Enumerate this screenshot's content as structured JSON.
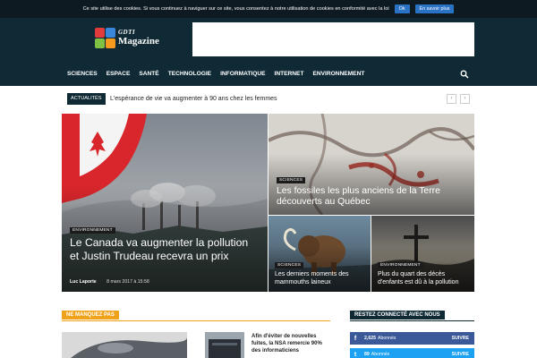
{
  "cookie": {
    "text": "Ce site utilise des cookies. Si vous continuez à naviguer sur ce site, vous consentez à notre utilisation de cookies en conformité avec la loi",
    "ok_label": "Ok",
    "more_label": "En savoir plus"
  },
  "logo": {
    "top": "GDTI",
    "bottom": "Magazine",
    "colors": [
      "#e23b3b",
      "#3a86d8",
      "#7ec143",
      "#f39a1f"
    ]
  },
  "nav": {
    "items": [
      "SCIENCES",
      "ESPACE",
      "SANTÉ",
      "TECHNOLOGIE",
      "INFORMATIQUE",
      "INTERNET",
      "ENVIRONNEMENT"
    ],
    "search_icon": "search-icon"
  },
  "ticker": {
    "label": "ACTUALITÉS",
    "headline": "L'espérance de vie va augmenter à 90 ans chez les femmes",
    "prev": "‹",
    "next": "›"
  },
  "featured": {
    "main": {
      "badge": "ENVIRONNEMENT",
      "title": "Le Canada va augmenter la pollution et Justin Trudeau recevra un prix",
      "author": "Luc Laporte",
      "date": "8 mars 2017 à 15:58"
    },
    "top_right": {
      "badge": "SCIENCES",
      "title": "Les fossiles les plus anciens de la Terre découverts au Québec"
    },
    "mid": {
      "badge": "SCIENCES",
      "title": "Les derniers moments des mammouths laineux"
    },
    "right": {
      "badge": "ENVIRONNEMENT",
      "title": "Plus du quart des décès d'enfants est dû à la pollution"
    }
  },
  "sections": {
    "missed": {
      "label": "NE MANQUEZ PAS",
      "article": "Afin d'éviter de nouvelles fuites, la NSA remercie 90% des informaticiens"
    },
    "social": {
      "label": "RESTEZ CONNECTÉ AVEC NOUS",
      "facebook": {
        "icon": "f",
        "count": "2,625",
        "label": "Abonnés",
        "button": "SUIVRE"
      },
      "twitter": {
        "icon": "t",
        "count": "89",
        "label": "Abonnés",
        "button": "SUIVRE"
      }
    }
  },
  "colors": {
    "header_bg": "#0f2a35",
    "accent_orange": "#f0a31a",
    "social_header": "#0f2a35",
    "facebook": "#3b5998",
    "twitter": "#1da1f2"
  }
}
